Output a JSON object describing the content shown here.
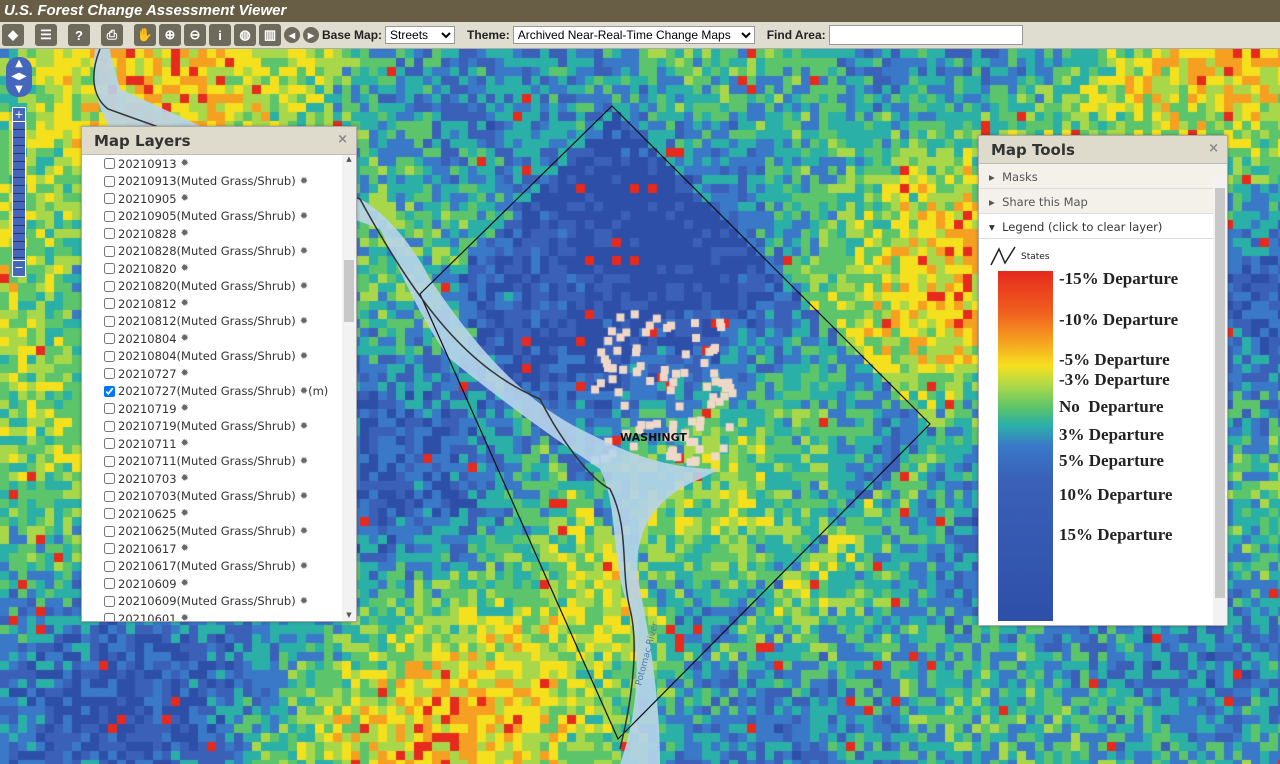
{
  "app": {
    "title": "U.S. Forest Change Assessment Viewer"
  },
  "toolbar": {
    "icons": [
      "layers-icon",
      "list-icon",
      "help-icon",
      "print-icon",
      "pan-icon",
      "zoom-in-icon",
      "zoom-out-icon",
      "identify-icon",
      "globe-icon",
      "chart-icon",
      "previous-extent-icon",
      "next-extent-icon"
    ],
    "base_map_label": "Base Map:",
    "base_map_value": "Streets",
    "theme_label": "Theme:",
    "theme_value": "Archived Near-Real-Time Change Maps",
    "find_area_label": "Find Area:",
    "find_area_value": ""
  },
  "map": {
    "place_label": "WASHINGT",
    "river_label": "Potomac River"
  },
  "layers_panel": {
    "title": "Map Layers",
    "close": "×",
    "items": [
      {
        "label": "20210913",
        "checked": false
      },
      {
        "label": "20210913(Muted Grass/Shrub)",
        "checked": false
      },
      {
        "label": "20210905",
        "checked": false
      },
      {
        "label": "20210905(Muted Grass/Shrub)",
        "checked": false
      },
      {
        "label": "20210828",
        "checked": false
      },
      {
        "label": "20210828(Muted Grass/Shrub)",
        "checked": false
      },
      {
        "label": "20210820",
        "checked": false
      },
      {
        "label": "20210820(Muted Grass/Shrub)",
        "checked": false
      },
      {
        "label": "20210812",
        "checked": false
      },
      {
        "label": "20210812(Muted Grass/Shrub)",
        "checked": false
      },
      {
        "label": "20210804",
        "checked": false
      },
      {
        "label": "20210804(Muted Grass/Shrub)",
        "checked": false
      },
      {
        "label": "20210727",
        "checked": false
      },
      {
        "label": "20210727(Muted Grass/Shrub)",
        "checked": true,
        "suffix": "(m)"
      },
      {
        "label": "20210719",
        "checked": false
      },
      {
        "label": "20210719(Muted Grass/Shrub)",
        "checked": false
      },
      {
        "label": "20210711",
        "checked": false
      },
      {
        "label": "20210711(Muted Grass/Shrub)",
        "checked": false
      },
      {
        "label": "20210703",
        "checked": false
      },
      {
        "label": "20210703(Muted Grass/Shrub)",
        "checked": false
      },
      {
        "label": "20210625",
        "checked": false
      },
      {
        "label": "20210625(Muted Grass/Shrub)",
        "checked": false
      },
      {
        "label": "20210617",
        "checked": false
      },
      {
        "label": "20210617(Muted Grass/Shrub)",
        "checked": false
      },
      {
        "label": "20210609",
        "checked": false
      },
      {
        "label": "20210609(Muted Grass/Shrub)",
        "checked": false
      },
      {
        "label": "20210601",
        "checked": false
      }
    ]
  },
  "tools_panel": {
    "title": "Map Tools",
    "close": "×",
    "sections": [
      "Masks",
      "Share this Map",
      "Legend (click to clear layer)"
    ],
    "legend": {
      "states_label": "States",
      "entries": [
        "-15% Departure",
        "-10% Departure",
        "-5% Departure",
        "-3% Departure",
        "No  Departure",
        "3% Departure",
        "5% Departure",
        "10% Departure",
        "15% Departure"
      ],
      "colors": [
        "#e62a1e",
        "#f5a020",
        "#f5e01e",
        "#5cc46a",
        "#2bb0a8",
        "#3a78c8",
        "#2e4fa8"
      ]
    }
  }
}
